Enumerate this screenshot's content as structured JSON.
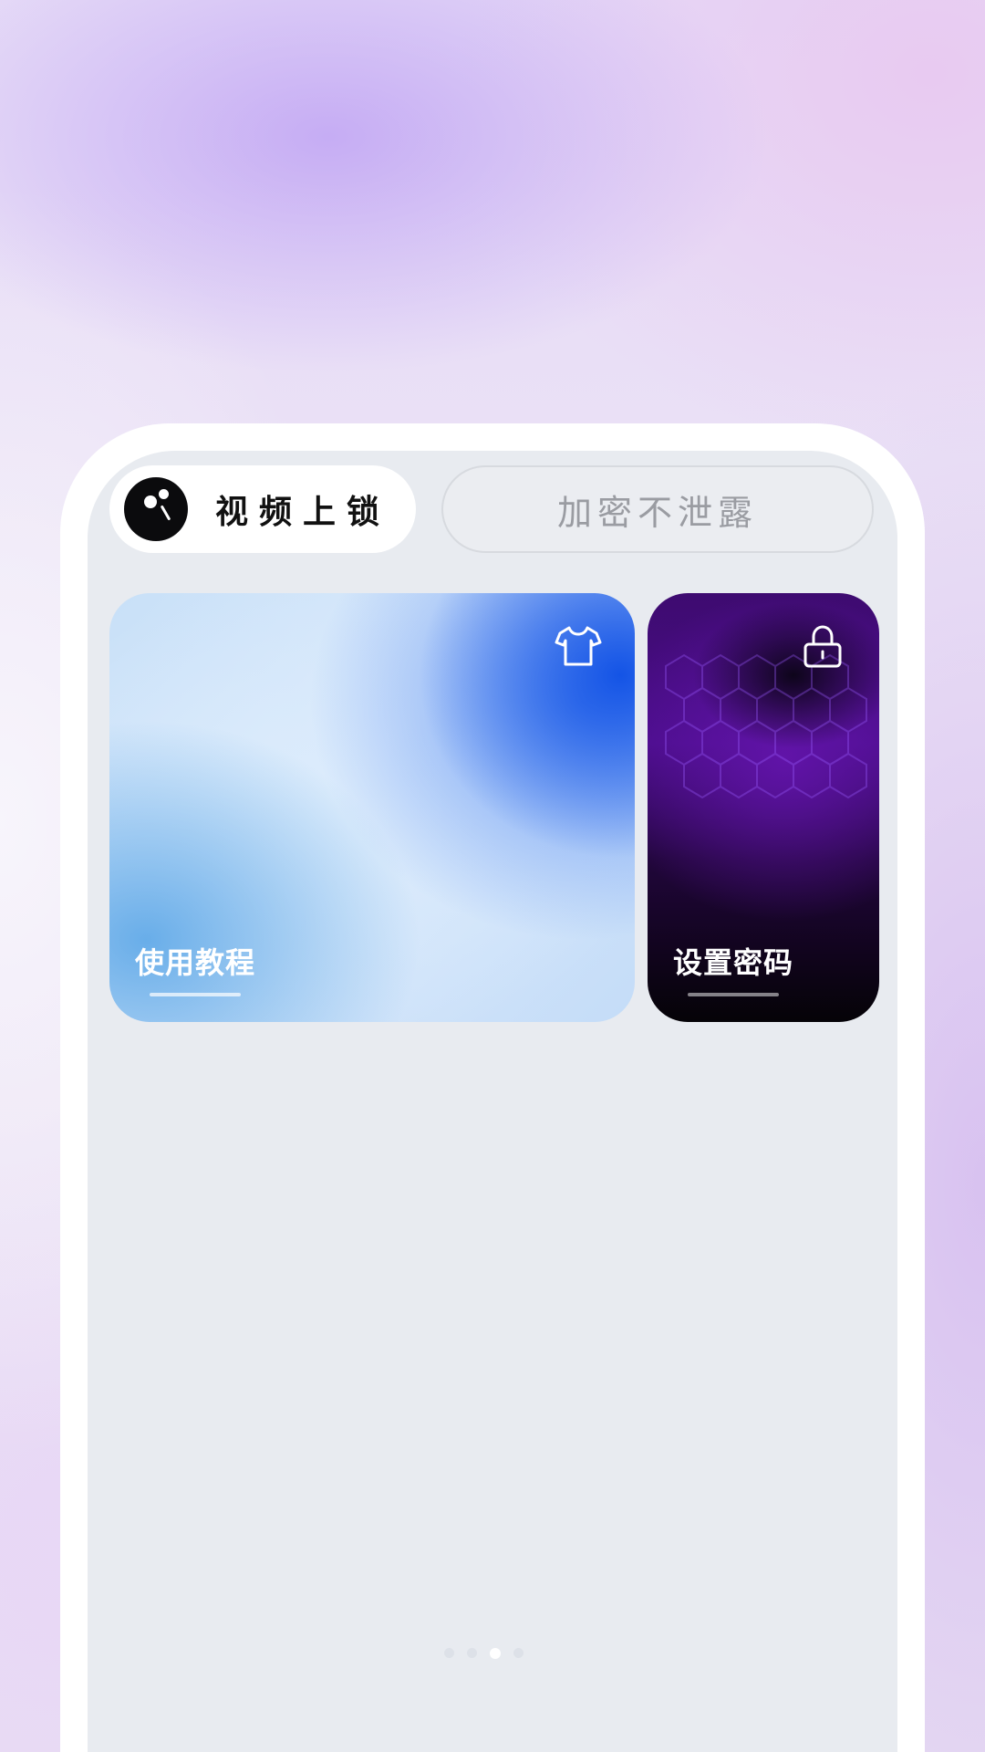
{
  "header": {
    "app_name": "视频上锁",
    "tagline": "加密不泄露"
  },
  "cards": [
    {
      "title": "使用教程",
      "icon": "tshirt-icon"
    },
    {
      "title": "设置密码",
      "icon": "lock-icon"
    }
  ],
  "pager": {
    "count": 4,
    "active_index": 2
  },
  "colors": {
    "background": "#e9def4",
    "screen": "#e8ebf0",
    "accent_blue": "#1454e6",
    "accent_purple": "#4a0d8a"
  }
}
